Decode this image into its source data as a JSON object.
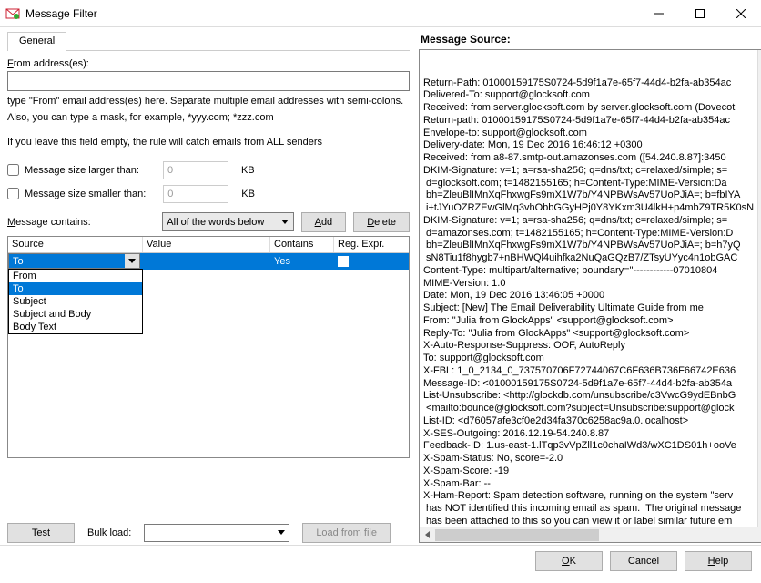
{
  "window": {
    "title": "Message Filter"
  },
  "tabs": {
    "general": "General"
  },
  "left": {
    "from_label": "From address(es):",
    "from_value": "",
    "from_help1": "type \"From\" email address(es) here. Separate multiple email addresses with semi-colons.",
    "from_help2": "Also, you can type a mask, for example, *yyy.com; *zzz.com",
    "from_help3": "If you leave this field empty, the rule will catch emails from ALL senders",
    "size_larger_label": "Message size larger than:",
    "size_larger_value": "0",
    "size_smaller_label": "Message size smaller than:",
    "size_smaller_value": "0",
    "kb": "KB",
    "contains_label": "Message contains:",
    "match_mode": "All of the words below",
    "add": "Add",
    "delete": "Delete",
    "columns": {
      "source": "Source",
      "value": "Value",
      "contains": "Contains",
      "regexpr": "Reg. Expr."
    },
    "row": {
      "source": "To",
      "value": "",
      "contains": "Yes",
      "regexpr": false
    },
    "dropdown": [
      "From",
      "To",
      "Subject",
      "Subject and Body",
      "Body Text"
    ],
    "dropdown_selected": "To",
    "test": "Test",
    "bulk_label": "Bulk load:",
    "bulk_value": "",
    "load_from_file": "Load from file"
  },
  "right": {
    "title": "Message Source:",
    "source_text": "Return-Path: 01000159175S0724-5d9f1a7e-65f7-44d4-b2fa-ab354ac\nDelivered-To: support@glocksoft.com\nReceived: from server.glocksoft.com by server.glocksoft.com (Dovecot\nReturn-path: 01000159175S0724-5d9f1a7e-65f7-44d4-b2fa-ab354ac\nEnvelope-to: support@glocksoft.com\nDelivery-date: Mon, 19 Dec 2016 16:46:12 +0300\nReceived: from a8-87.smtp-out.amazonses.com ([54.240.8.87]:3450\nDKIM-Signature: v=1; a=rsa-sha256; q=dns/txt; c=relaxed/simple; s=\n d=glocksoft.com; t=1482155165; h=Content-Type:MIME-Version:Da\n bh=ZleuBlIMnXqFhxwgFs9mX1W7b/Y4NPBWsAv57UoPJiA=; b=fbIYA\n i+tJYuOZRZEwGlMq3vhObbGGyHPj0Y8YKxm3U4lkH+p4mbZ9TR5K0sN\nDKIM-Signature: v=1; a=rsa-sha256; q=dns/txt; c=relaxed/simple; s=\n d=amazonses.com; t=1482155165; h=Content-Type:MIME-Version:D\n bh=ZleuBlIMnXqFhxwgFs9mX1W7b/Y4NPBWsAv57UoPJiA=; b=h7yQ\n sN8Tiu1f8hygb7+nBHWQl4uihfka2NuQaGQzB7/ZTsyUYyc4n1obGAC\nContent-Type: multipart/alternative; boundary=\"------------07010804\nMIME-Version: 1.0\nDate: Mon, 19 Dec 2016 13:46:05 +0000\nSubject: [New] The Email Deliverability Ultimate Guide from me\nFrom: \"Julia from GlockApps\" <support@glocksoft.com>\nReply-To: \"Julia from GlockApps\" <support@glocksoft.com>\nX-Auto-Response-Suppress: OOF, AutoReply\nTo: support@glocksoft.com\nX-FBL: 1_0_2134_0_737570706F72744067C6F636B736F66742E636\nMessage-ID: <01000159175S0724-5d9f1a7e-65f7-44d4-b2fa-ab354a\nList-Unsubscribe: <http://glockdb.com/unsubscribe/c3VwcG9ydEBnbG\n <mailto:bounce@glocksoft.com?subject=Unsubscribe:support@glock\nList-ID: <d76057afe3cf0e2d34fa370c6258ac9a.0.localhost>\nX-SES-Outgoing: 2016.12.19-54.240.8.87\nFeedback-ID: 1.us-east-1.lTqp3vVpZll1c0chaIWd3/wXC1DS01h+ooVe\nX-Spam-Status: No, score=-2.0\nX-Spam-Score: -19\nX-Spam-Bar: --\nX-Ham-Report: Spam detection software, running on the system \"serv\n has NOT identified this incoming email as spam.  The original message\n has been attached to this so you can view it or label similar future em\n  If you have any questions, see root\\@localhost for details.  Content\n preview:  ... how to send to Inbox, from the ground up Hi , I wanted\n  to reach you out and let you know that my article \"Email Deliverabili\n was published on the http://peterbeckenham.com/ blog.  [...]   Cont"
  },
  "footer": {
    "ok": "OK",
    "cancel": "Cancel",
    "help": "Help"
  }
}
